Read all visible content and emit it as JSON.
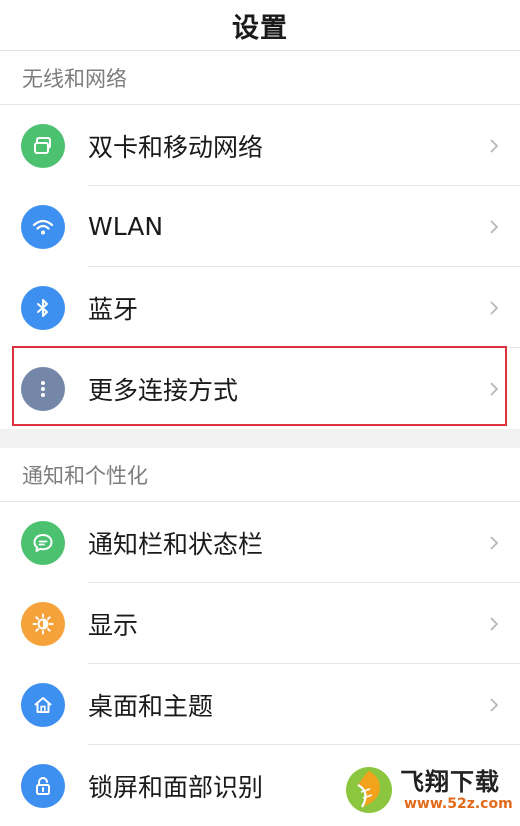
{
  "header": {
    "title": "设置"
  },
  "sections": [
    {
      "title": "无线和网络",
      "items": [
        {
          "label": "双卡和移动网络",
          "icon": "dual-sim-icon",
          "color": "#4cc170"
        },
        {
          "label": "WLAN",
          "icon": "wifi-icon",
          "color": "#3d8ff0"
        },
        {
          "label": "蓝牙",
          "icon": "bluetooth-icon",
          "color": "#3d8ff0"
        },
        {
          "label": "更多连接方式",
          "icon": "more-dots-icon",
          "color": "#7587a8"
        }
      ]
    },
    {
      "title": "通知和个性化",
      "items": [
        {
          "label": "通知栏和状态栏",
          "icon": "chat-bubble-icon",
          "color": "#4cc170"
        },
        {
          "label": "显示",
          "icon": "brightness-icon",
          "color": "#f5a23a"
        },
        {
          "label": "桌面和主题",
          "icon": "home-icon",
          "color": "#3d8ff0"
        },
        {
          "label": "锁屏和面部识别",
          "icon": "lock-icon",
          "color": "#3d8ff0"
        }
      ]
    }
  ],
  "highlight": {
    "color": "#e0313c",
    "target": "更多连接方式"
  },
  "watermark": {
    "brand": "飞翔下载",
    "url": "www.52z.com"
  }
}
